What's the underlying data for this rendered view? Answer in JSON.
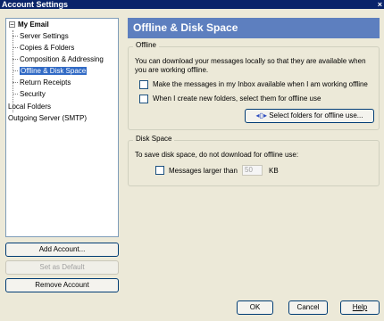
{
  "window": {
    "title": "Account Settings"
  },
  "tree": {
    "root": "My Email",
    "children": [
      "Server Settings",
      "Copies & Folders",
      "Composition & Addressing",
      "Offline & Disk Space",
      "Return Receipts",
      "Security"
    ],
    "others": [
      "Local Folders",
      "Outgoing Server (SMTP)"
    ]
  },
  "left_buttons": {
    "add": "Add Account...",
    "default": "Set as Default",
    "remove": "Remove Account"
  },
  "panel": {
    "title": "Offline & Disk Space",
    "offline": {
      "group_title": "Offline",
      "description_line1": "You can download your messages locally so that they are available when",
      "description_line2": "you are working offline.",
      "option1": "Make the messages in my Inbox available when I am working offline",
      "option2": "When I create new folders, select them for offline use",
      "select_button": "Select folders for offline use..."
    },
    "disk": {
      "group_title": "Disk Space",
      "description": "To save disk space, do not download for offline use:",
      "option": "Messages larger than",
      "size_value": "50",
      "unit": "KB"
    }
  },
  "footer": {
    "ok": "OK",
    "cancel": "Cancel",
    "help": "Help"
  }
}
